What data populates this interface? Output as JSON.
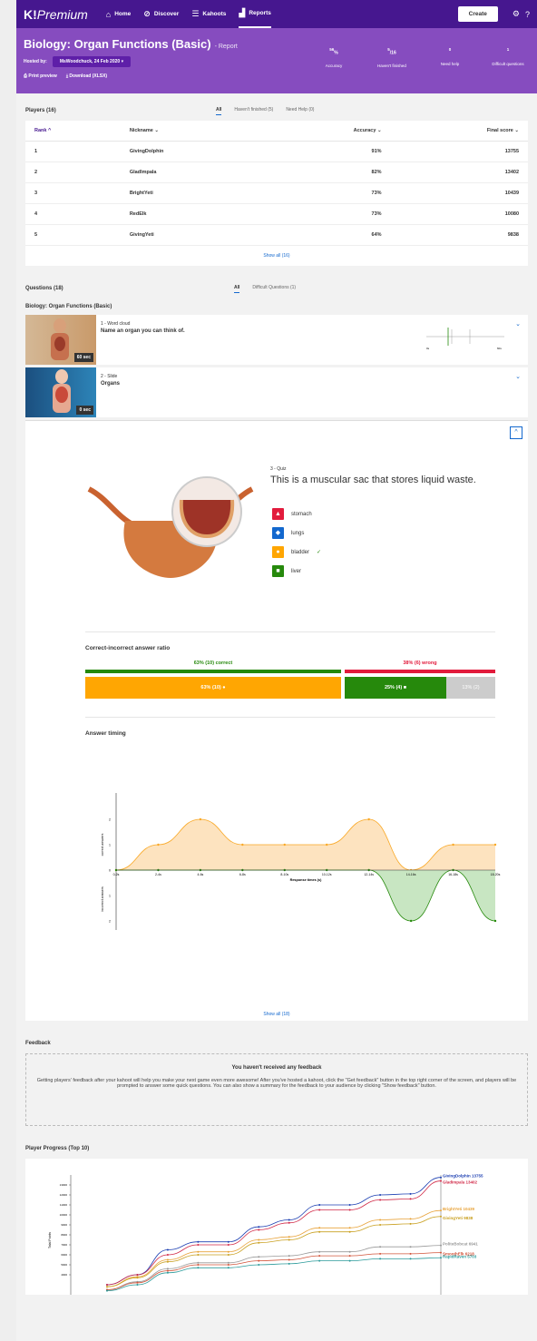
{
  "nav": {
    "logo_brand": "K!",
    "logo_tier": "Premium",
    "items": [
      {
        "label": "Home",
        "icon": "home-icon"
      },
      {
        "label": "Discover",
        "icon": "compass-icon"
      },
      {
        "label": "Kahoots",
        "icon": "list-icon"
      },
      {
        "label": "Reports",
        "icon": "bar-chart-icon"
      }
    ],
    "create_label": "Create"
  },
  "report": {
    "title": "Biology: Organ Functions (Basic)",
    "title_suffix": "- Report",
    "hosted_label": "Hosted by:",
    "hosted_value": "MsWoodchuck, 24 Feb 2020",
    "print_label": "Print preview",
    "download_label": "Download (XLSX)"
  },
  "stats": [
    {
      "value": "56",
      "unit": "%",
      "label": "Accuracy"
    },
    {
      "value": "5",
      "unit": "/16",
      "label": "Haven't finished"
    },
    {
      "value": "0",
      "unit": "",
      "label": "Need help"
    },
    {
      "value": "1",
      "unit": "",
      "label": "Difficult questions"
    }
  ],
  "players": {
    "title": "Players (16)",
    "filters": [
      "All",
      "Haven't finished (5)",
      "Need Help (0)"
    ],
    "columns": [
      "Rank",
      "Nickname",
      "Accuracy",
      "Final score"
    ],
    "rows": [
      [
        "1",
        "GivingDolphin",
        "91%",
        "13755"
      ],
      [
        "2",
        "GladImpala",
        "82%",
        "13402"
      ],
      [
        "3",
        "BrightYeti",
        "73%",
        "10439"
      ],
      [
        "4",
        "RedElk",
        "73%",
        "10080"
      ],
      [
        "5",
        "GivingYeti",
        "64%",
        "9838"
      ]
    ],
    "show_all": "Show all (16)"
  },
  "questions": {
    "title": "Questions (18)",
    "filters": [
      "All",
      "Difficult Questions (1)"
    ],
    "quiz_name": "Biology: Organ Functions (Basic)",
    "items": [
      {
        "type": "1 - Word cloud",
        "text": "Name an organ you can think of.",
        "time": "60 sec"
      },
      {
        "type": "2 - Slide",
        "text": "Organs",
        "time": "0 sec"
      }
    ],
    "q3": {
      "type": "3 - Quiz",
      "text": "This is a muscular sac that stores liquid waste.",
      "answers": [
        {
          "label": "stomach",
          "color": "#e21b3c",
          "shape": "▲",
          "correct": ""
        },
        {
          "label": "lungs",
          "color": "#1368ce",
          "shape": "◆",
          "correct": ""
        },
        {
          "label": "bladder",
          "color": "#ffa602",
          "shape": "●",
          "correct": "✓"
        },
        {
          "label": "liver",
          "color": "#26890c",
          "shape": "■",
          "correct": ""
        }
      ]
    },
    "ratio_title": "Correct-incorrect answer ratio",
    "correct_label": "63% (10) correct",
    "wrong_label": "38% (6) wrong",
    "bar_labels": [
      "63% (10) ●",
      "25% (4) ■",
      "13% (2)"
    ],
    "timing_title": "Answer timing",
    "show_all": "Show all (18)"
  },
  "feedback": {
    "title": "Feedback",
    "heading": "You haven't received any feedback",
    "body": "Getting players' feedback after your kahoot will help you make your next game even more awesome! After you've hosted a kahoot, click the \"Get feedback\" button in the top right corner of the screen, and players will be prompted to answer some quick questions. You can also show a summary for the feedback to your audience by clicking \"Show feedback\" button."
  },
  "progress": {
    "title": "Player Progress (Top 10)",
    "ylabel": "Total Points"
  },
  "chart_data": [
    {
      "type": "area",
      "title": "Answer timing",
      "xlabel": "Response times (s)",
      "ylabel": "correct answers",
      "categories": [
        "0-2s",
        "2-4s",
        "4-6s",
        "6-8s",
        "8-10s",
        "10-12s",
        "12-14s",
        "14-16s",
        "16-18s",
        "18-20s"
      ],
      "series": [
        {
          "values": [
            0,
            1,
            2,
            1,
            1,
            1,
            2,
            0,
            1,
            1
          ]
        }
      ],
      "ylim": [
        0,
        2
      ],
      "color": "#f9a825"
    },
    {
      "type": "area",
      "xlabel": "Response times (s)",
      "ylabel": "incorrect answers",
      "categories": [
        "0-2s",
        "2-4s",
        "4-6s",
        "6-8s",
        "8-10s",
        "10-12s",
        "12-14s",
        "14-16s",
        "16-18s",
        "18-20s"
      ],
      "series": [
        {
          "values": [
            0,
            0,
            0,
            0,
            0,
            0,
            0,
            2,
            0,
            2
          ]
        }
      ],
      "ylim": [
        0,
        2
      ],
      "color": "#26890c"
    },
    {
      "type": "line",
      "title": "Player Progress (Top 10)",
      "ylabel": "Total Points",
      "yticks": [
        4000,
        5000,
        6000,
        7000,
        8000,
        9000,
        10000,
        11000,
        12000,
        13000
      ],
      "series": [
        {
          "name": "GivingDolphin 13755",
          "color": "#1c3fb2",
          "values": [
            3000,
            4000,
            6500,
            7300,
            7300,
            8800,
            9500,
            11000,
            11000,
            12000,
            12100,
            13755
          ]
        },
        {
          "name": "GladImpala 13402",
          "color": "#d12a48",
          "values": [
            3000,
            4000,
            6000,
            7000,
            7000,
            8500,
            9200,
            10500,
            10500,
            11500,
            11600,
            13402
          ]
        },
        {
          "name": "BrightYeti 10439",
          "color": "#e8a33a",
          "values": [
            2800,
            3800,
            5500,
            6300,
            6300,
            7500,
            7800,
            8700,
            8700,
            9500,
            9600,
            10439
          ]
        },
        {
          "name": "GivingYeti 9838",
          "color": "#c9a020",
          "values": [
            2800,
            3700,
            5300,
            6000,
            6000,
            7200,
            7500,
            8300,
            8300,
            9000,
            9100,
            9838
          ]
        },
        {
          "name": "PoliteBobcat 6941",
          "color": "#999999",
          "values": [
            2500,
            3300,
            4600,
            5200,
            5200,
            5800,
            5900,
            6300,
            6300,
            6800,
            6800,
            6941
          ]
        },
        {
          "name": "SmoothElk 6218",
          "color": "#d2543a",
          "values": [
            2500,
            3200,
            4400,
            5000,
            5000,
            5400,
            5500,
            5900,
            5900,
            6100,
            6100,
            6218
          ]
        },
        {
          "name": "RapidRaven 5703",
          "color": "#2a9a9a",
          "values": [
            2400,
            3000,
            4200,
            4700,
            4700,
            5000,
            5100,
            5400,
            5400,
            5600,
            5600,
            5703
          ]
        }
      ]
    }
  ]
}
